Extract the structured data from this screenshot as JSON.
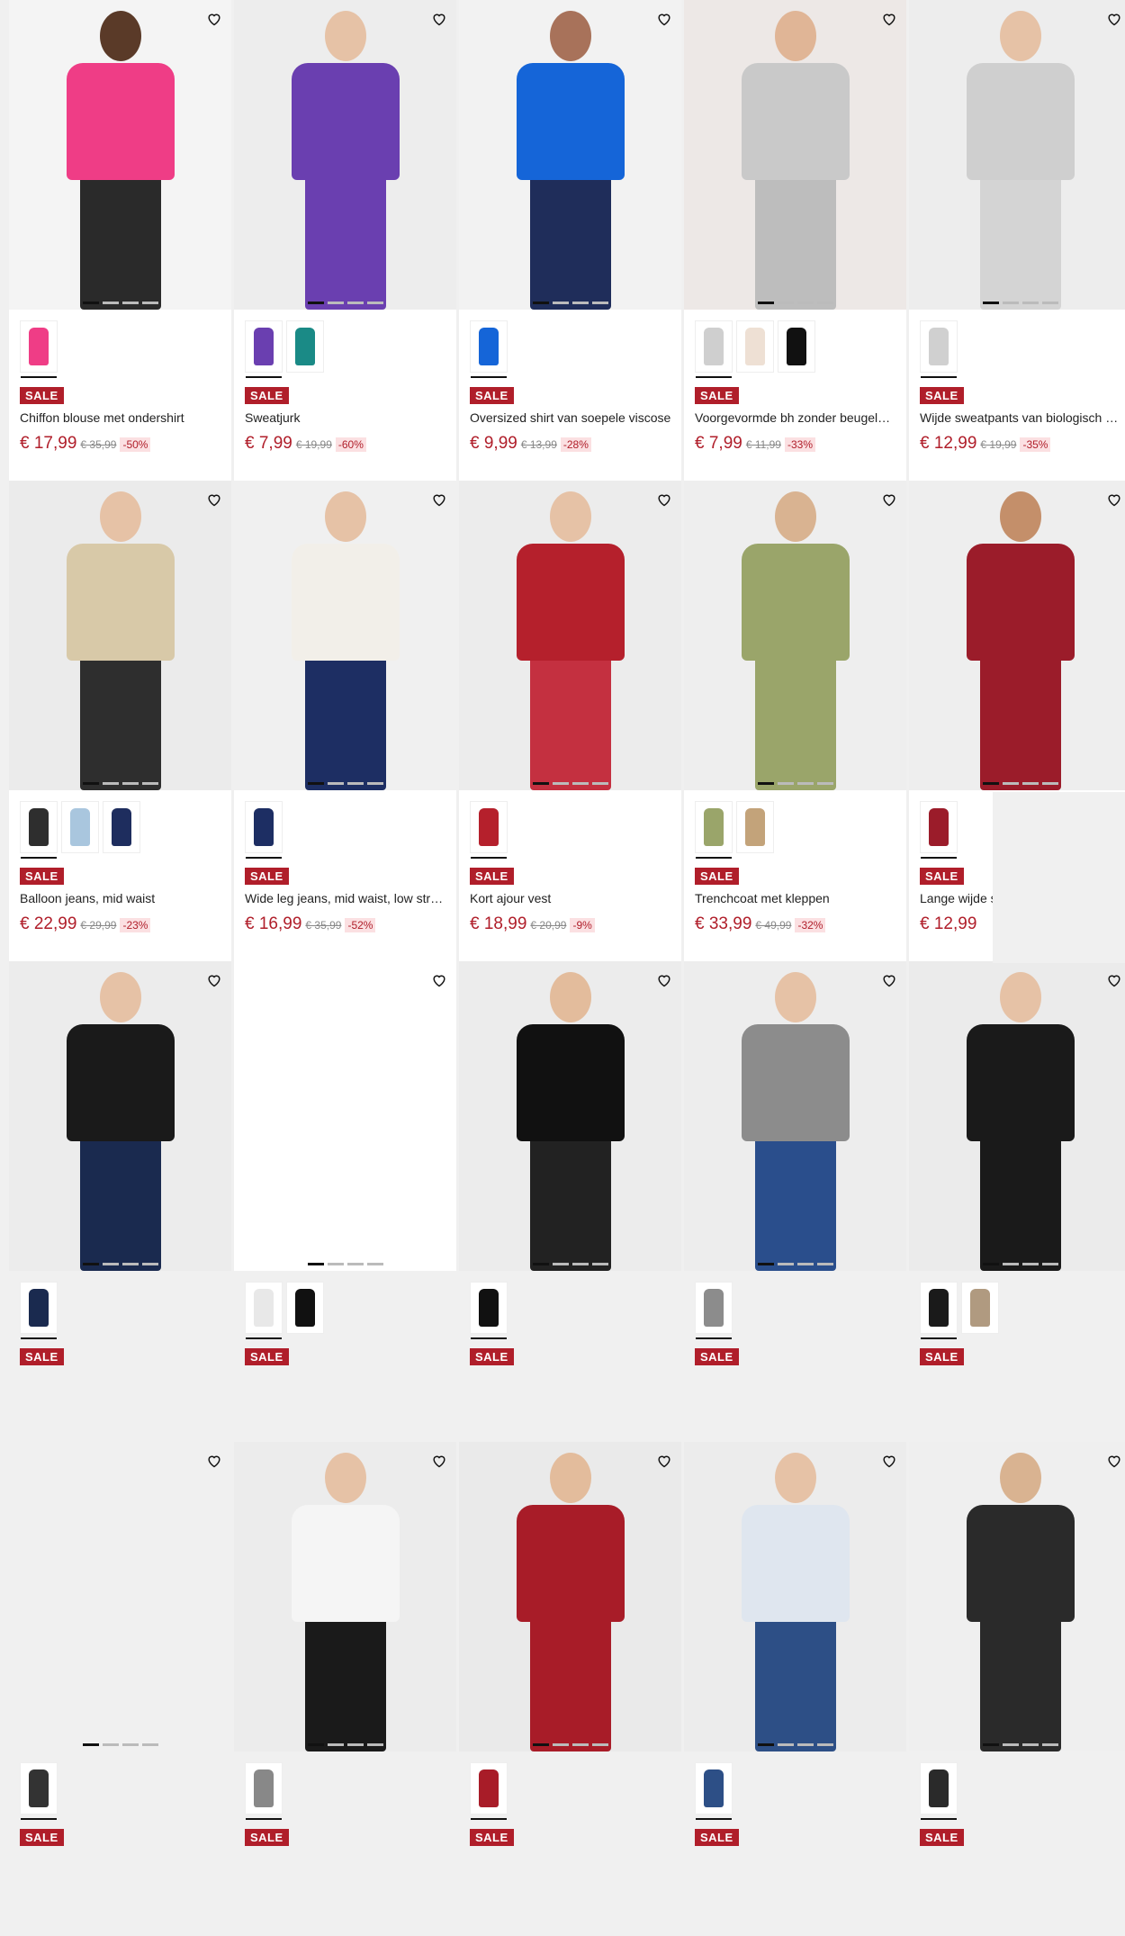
{
  "products": [
    {
      "name": "Chiffon blouse met ondershirt",
      "price": "€ 17,99",
      "was": "€ 35,99",
      "pct": "-50%",
      "bg": "#f4f4f4",
      "top": "#ef3d86",
      "bottom": "#2a2a2a",
      "skin": "#5a3a28",
      "swatches": [
        "#ef3d86"
      ]
    },
    {
      "name": "Sweatjurk",
      "price": "€ 7,99",
      "was": "€ 19,99",
      "pct": "-60%",
      "bg": "#ededed",
      "top": "#6a3fb0",
      "bottom": "#6a3fb0",
      "skin": "#e6c2a6",
      "swatches": [
        "#6a3fb0",
        "#1a8a86"
      ]
    },
    {
      "name": "Oversized shirt van soepele viscose",
      "price": "€ 9,99",
      "was": "€ 13,99",
      "pct": "-28%",
      "bg": "#f2f2f2",
      "top": "#1565d8",
      "bottom": "#1f2d5a",
      "skin": "#a8725a",
      "swatches": [
        "#1565d8"
      ]
    },
    {
      "name": "Voorgevormde bh zonder beugel…",
      "price": "€ 7,99",
      "was": "€ 11,99",
      "pct": "-33%",
      "bg": "#ede8e6",
      "top": "#c9c9c9",
      "bottom": "#bdbdbd",
      "skin": "#e0b596",
      "swatches": [
        "#cfcfcf",
        "#eee0d4",
        "#111111"
      ]
    },
    {
      "name": "Wijde sweatpants van biologisch …",
      "price": "€ 12,99",
      "was": "€ 19,99",
      "pct": "-35%",
      "bg": "#ededed",
      "top": "#cfcfcf",
      "bottom": "#d4d4d4",
      "skin": "#e6c2a6",
      "swatches": [
        "#d0d0d0"
      ]
    },
    {
      "name": "Balloon jeans, mid waist",
      "price": "€ 22,99",
      "was": "€ 29,99",
      "pct": "-23%",
      "bg": "#ebebeb",
      "top": "#d8c9a8",
      "bottom": "#2e2e2e",
      "skin": "#e6c2a6",
      "swatches": [
        "#2e2e2e",
        "#a9c6de",
        "#1e2d5e"
      ]
    },
    {
      "name": "Wide leg jeans, mid waist, low str…",
      "price": "€ 16,99",
      "was": "€ 35,99",
      "pct": "-52%",
      "bg": "#f0f0f0",
      "top": "#f2efe9",
      "bottom": "#1d2e63",
      "skin": "#e6c2a6",
      "swatches": [
        "#1d2e63"
      ]
    },
    {
      "name": "Kort ajour vest",
      "price": "€ 18,99",
      "was": "€ 20,99",
      "pct": "-9%",
      "bg": "#ececec",
      "top": "#b5202c",
      "bottom": "#c43040",
      "skin": "#e6c2a6",
      "swatches": [
        "#b5202c"
      ]
    },
    {
      "name": "Trenchcoat met kleppen",
      "price": "€ 33,99",
      "was": "€ 49,99",
      "pct": "-32%",
      "bg": "#eeeeee",
      "top": "#9aa56a",
      "bottom": "#9aa56a",
      "skin": "#d9b391",
      "swatches": [
        "#9aa56a",
        "#c3a37a"
      ]
    },
    {
      "name": "Lange wijde s…",
      "price": "€ 12,99",
      "was": "",
      "pct": "",
      "bg": "#eeeeee",
      "top": "#9b1c2a",
      "bottom": "#9b1c2a",
      "skin": "#c48f6a",
      "swatches": [
        "#9b1c2a"
      ]
    },
    {
      "name": "",
      "price": "",
      "was": "",
      "pct": "",
      "bg": "#ececec",
      "top": "#1a1a1a",
      "bottom": "#1a2a4f",
      "skin": "#e6c2a6",
      "swatches": [
        "#1a2a4f"
      ]
    },
    {
      "name": "",
      "price": "",
      "was": "",
      "pct": "",
      "bg": "#ffffff",
      "top": "#ffffff",
      "bottom": "#ffffff",
      "skin": "#ffffff",
      "swatches": [
        "#e8e8e8",
        "#111111"
      ]
    },
    {
      "name": "",
      "price": "",
      "was": "",
      "pct": "",
      "bg": "#ececec",
      "top": "#111111",
      "bottom": "#222222",
      "skin": "#e3bc9c",
      "swatches": [
        "#111111"
      ]
    },
    {
      "name": "",
      "price": "",
      "was": "",
      "pct": "",
      "bg": "#ededed",
      "top": "#8c8c8c",
      "bottom": "#2a4e8c",
      "skin": "#e6c2a6",
      "swatches": [
        "#8c8c8c"
      ]
    },
    {
      "name": "",
      "price": "",
      "was": "",
      "pct": "",
      "bg": "#ebebeb",
      "top": "#1a1a1a",
      "bottom": "#1a1a1a",
      "skin": "#e6c2a6",
      "swatches": [
        "#1a1a1a",
        "#b09a80"
      ]
    },
    {
      "name": "",
      "price": "",
      "was": "",
      "pct": "",
      "bg": "#f0f0f0",
      "top": "#f0f0f0",
      "bottom": "#f0f0f0",
      "skin": "#f0f0f0",
      "swatches": [
        "#333333"
      ]
    },
    {
      "name": "",
      "price": "",
      "was": "",
      "pct": "",
      "bg": "#ececec",
      "top": "#f5f5f5",
      "bottom": "#1a1a1a",
      "skin": "#e6c2a6",
      "swatches": [
        "#888888"
      ]
    },
    {
      "name": "",
      "price": "",
      "was": "",
      "pct": "",
      "bg": "#eaeaea",
      "top": "#a81c28",
      "bottom": "#a81c28",
      "skin": "#e3bc9c",
      "swatches": [
        "#a81c28"
      ]
    },
    {
      "name": "",
      "price": "",
      "was": "",
      "pct": "",
      "bg": "#ececec",
      "top": "#dfe6ef",
      "bottom": "#2d4f86",
      "skin": "#e6c2a6",
      "swatches": [
        "#2d4f86"
      ]
    },
    {
      "name": "",
      "price": "",
      "was": "",
      "pct": "",
      "bg": "#efefef",
      "top": "#2a2a2a",
      "bottom": "#2a2a2a",
      "skin": "#d9b391",
      "swatches": [
        "#2a2a2a"
      ]
    }
  ],
  "labels": {
    "sale": "SALE",
    "wishlist_icon": "heart-icon"
  }
}
